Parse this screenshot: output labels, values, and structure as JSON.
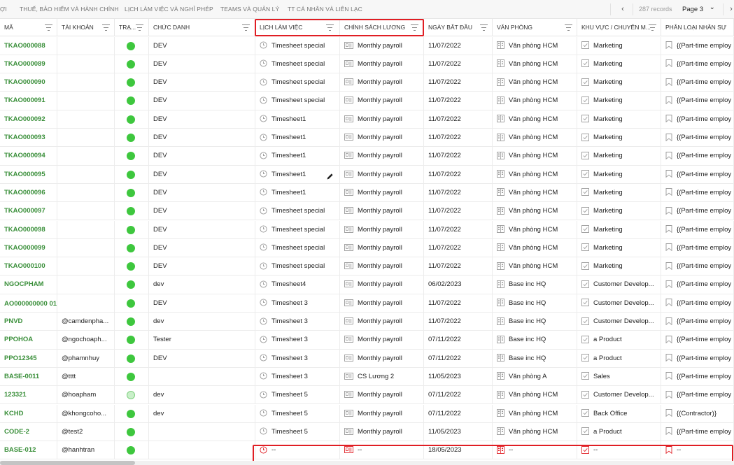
{
  "tabs": [
    "ỢI",
    "THUẾ, BẢO HIỂM VÀ HÀNH CHÍNH",
    "LỊCH LÀM VIỆC VÀ NGHỈ PHÉP",
    "TEAMS VÀ QUẢN LÝ",
    "TT CÁ NHÂN VÀ LIÊN LẠC"
  ],
  "pager": {
    "prev_glyph": "‹",
    "records": "287 records",
    "page": "Page 3",
    "page_chevron": "⌄",
    "next_glyph": "›"
  },
  "columns": [
    "MÃ",
    "TÀI KHOẢN",
    "TRẠ...",
    "CHỨC DANH",
    "LỊCH LÀM VIỆC",
    "CHÍNH SÁCH LƯƠNG",
    "NGÀY BẮT ĐẦU",
    "VĂN PHÒNG",
    "KHU VỰC / CHUYÊN M...",
    "PHÂN LOẠI NHÂN SỰ"
  ],
  "colors": {
    "code_green": "#3a8f3a",
    "status_green": "#3ec73e",
    "highlight_red": "#e01e24"
  },
  "rows": [
    {
      "code": "TKAO000088",
      "account": "",
      "status": "active",
      "title": "DEV",
      "schedule": "Timesheet special",
      "payroll": "Monthly payroll",
      "start": "11/07/2022",
      "office": "Văn phòng HCM",
      "area": "Marketing",
      "type": "{(Part-time employ"
    },
    {
      "code": "TKAO000089",
      "account": "",
      "status": "active",
      "title": "DEV",
      "schedule": "Timesheet special",
      "payroll": "Monthly payroll",
      "start": "11/07/2022",
      "office": "Văn phòng HCM",
      "area": "Marketing",
      "type": "{(Part-time employ"
    },
    {
      "code": "TKAO000090",
      "account": "",
      "status": "active",
      "title": "DEV",
      "schedule": "Timesheet special",
      "payroll": "Monthly payroll",
      "start": "11/07/2022",
      "office": "Văn phòng HCM",
      "area": "Marketing",
      "type": "{(Part-time employ"
    },
    {
      "code": "TKAO000091",
      "account": "",
      "status": "active",
      "title": "DEV",
      "schedule": "Timesheet special",
      "payroll": "Monthly payroll",
      "start": "11/07/2022",
      "office": "Văn phòng HCM",
      "area": "Marketing",
      "type": "{(Part-time employ"
    },
    {
      "code": "TKAO000092",
      "account": "",
      "status": "active",
      "title": "DEV",
      "schedule": "Timesheet1",
      "payroll": "Monthly payroll",
      "start": "11/07/2022",
      "office": "Văn phòng HCM",
      "area": "Marketing",
      "type": "{(Part-time employ"
    },
    {
      "code": "TKAO000093",
      "account": "",
      "status": "active",
      "title": "DEV",
      "schedule": "Timesheet1",
      "payroll": "Monthly payroll",
      "start": "11/07/2022",
      "office": "Văn phòng HCM",
      "area": "Marketing",
      "type": "{(Part-time employ"
    },
    {
      "code": "TKAO000094",
      "account": "",
      "status": "active",
      "title": "DEV",
      "schedule": "Timesheet1",
      "payroll": "Monthly payroll",
      "start": "11/07/2022",
      "office": "Văn phòng HCM",
      "area": "Marketing",
      "type": "{(Part-time employ"
    },
    {
      "code": "TKAO000095",
      "account": "",
      "status": "active",
      "title": "DEV",
      "schedule": "Timesheet1",
      "payroll": "Monthly payroll",
      "start": "11/07/2022",
      "office": "Văn phòng HCM",
      "area": "Marketing",
      "type": "{(Part-time employ",
      "edit": true
    },
    {
      "code": "TKAO000096",
      "account": "",
      "status": "active",
      "title": "DEV",
      "schedule": "Timesheet1",
      "payroll": "Monthly payroll",
      "start": "11/07/2022",
      "office": "Văn phòng HCM",
      "area": "Marketing",
      "type": "{(Part-time employ"
    },
    {
      "code": "TKAO000097",
      "account": "",
      "status": "active",
      "title": "DEV",
      "schedule": "Timesheet special",
      "payroll": "Monthly payroll",
      "start": "11/07/2022",
      "office": "Văn phòng HCM",
      "area": "Marketing",
      "type": "{(Part-time employ"
    },
    {
      "code": "TKAO000098",
      "account": "",
      "status": "active",
      "title": "DEV",
      "schedule": "Timesheet special",
      "payroll": "Monthly payroll",
      "start": "11/07/2022",
      "office": "Văn phòng HCM",
      "area": "Marketing",
      "type": "{(Part-time employ"
    },
    {
      "code": "TKAO000099",
      "account": "",
      "status": "active",
      "title": "DEV",
      "schedule": "Timesheet special",
      "payroll": "Monthly payroll",
      "start": "11/07/2022",
      "office": "Văn phòng HCM",
      "area": "Marketing",
      "type": "{(Part-time employ"
    },
    {
      "code": "TKAO000100",
      "account": "",
      "status": "active",
      "title": "DEV",
      "schedule": "Timesheet special",
      "payroll": "Monthly payroll",
      "start": "11/07/2022",
      "office": "Văn phòng HCM",
      "area": "Marketing",
      "type": "{(Part-time employ"
    },
    {
      "code": "NGOCPHAM",
      "account": "",
      "status": "active",
      "title": "dev",
      "schedule": "Timesheet4",
      "payroll": "Monthly payroll",
      "start": "06/02/2023",
      "office": "Base inc HQ",
      "area": "Customer Develop...",
      "type": "{(Part-time employ"
    },
    {
      "code": "AO000000000 01",
      "account": "",
      "status": "active",
      "title": "DEV",
      "schedule": "Timesheet 3",
      "payroll": "Monthly payroll",
      "start": "11/07/2022",
      "office": "Base inc HQ",
      "area": "Customer Develop...",
      "type": "{(Part-time employ",
      "wrap": true
    },
    {
      "code": "PNVD",
      "account": "@camdenpha...",
      "status": "active",
      "title": "dev",
      "schedule": "Timesheet 3",
      "payroll": "Monthly payroll",
      "start": "11/07/2022",
      "office": "Base inc HQ",
      "area": "Customer Develop...",
      "type": "{(Part-time employ"
    },
    {
      "code": "PPOHOA",
      "account": "@ngochoaph...",
      "status": "active",
      "title": "Tester",
      "schedule": "Timesheet 3",
      "payroll": "Monthly payroll",
      "start": "07/11/2022",
      "office": "Base inc HQ",
      "area": "a Product",
      "type": "{(Part-time employ"
    },
    {
      "code": "PPO12345",
      "account": "@phamnhuy",
      "status": "active",
      "title": "DEV",
      "schedule": "Timesheet 3",
      "payroll": "Monthly payroll",
      "start": "07/11/2022",
      "office": "Base inc HQ",
      "area": "a Product",
      "type": "{(Part-time employ"
    },
    {
      "code": "BASE-0011",
      "account": "@tttt",
      "status": "active",
      "title": "",
      "schedule": "Timesheet 3",
      "payroll": "CS Lương 2",
      "start": "11/05/2023",
      "office": "Văn phòng A",
      "area": "Sales",
      "type": "{(Part-time employ"
    },
    {
      "code": "123321",
      "account": "@hoapham",
      "status": "inactive",
      "title": "dev",
      "schedule": "Timesheet 5",
      "payroll": "Monthly payroll",
      "start": "07/11/2022",
      "office": "Văn phòng HCM",
      "area": "Customer Develop...",
      "type": "{(Part-time employ"
    },
    {
      "code": "KCHD",
      "account": "@khongcoho...",
      "status": "active",
      "title": "dev",
      "schedule": "Timesheet 5",
      "payroll": "Monthly payroll",
      "start": "07/11/2022",
      "office": "Văn phòng HCM",
      "area": "Back Office",
      "type": "{(Contractor)}"
    },
    {
      "code": "CODE-2",
      "account": "@test2",
      "status": "active",
      "title": "",
      "schedule": "Timesheet 5",
      "payroll": "Monthly payroll",
      "start": "11/05/2023",
      "office": "Văn phòng HCM",
      "area": "a Product",
      "type": "{(Part-time employ"
    },
    {
      "code": "BASE-012",
      "account": "@hanhtran",
      "status": "active",
      "title": "",
      "schedule": "--",
      "payroll": "--",
      "start": "18/05/2023",
      "office": "--",
      "area": "--",
      "type": "--",
      "red_icons": true
    }
  ]
}
